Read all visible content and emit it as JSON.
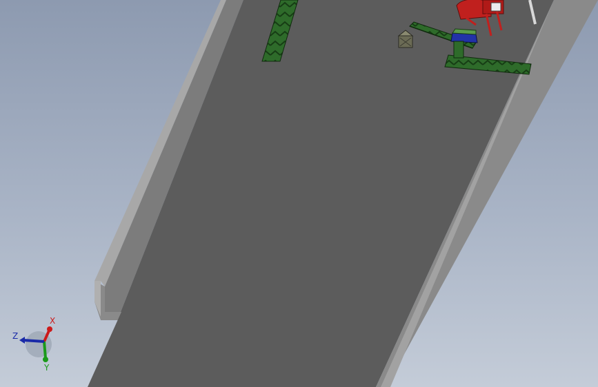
{
  "colors": {
    "background_top": "#8d9ab0",
    "background_bottom": "#c4ccd8",
    "floor": "#5c5c5c",
    "wall_top": "#a4a4a4",
    "wall_side": "#7a7a7a",
    "conveyor": "#2e6b2a",
    "machine_red": "#c0201e",
    "machine_blue": "#2232a8",
    "axis_x": "#cc1a1a",
    "axis_y": "#1a9a1a",
    "axis_z": "#1a2aa8"
  },
  "triad": {
    "x_label": "X",
    "y_label": "Y",
    "z_label": "Z"
  }
}
